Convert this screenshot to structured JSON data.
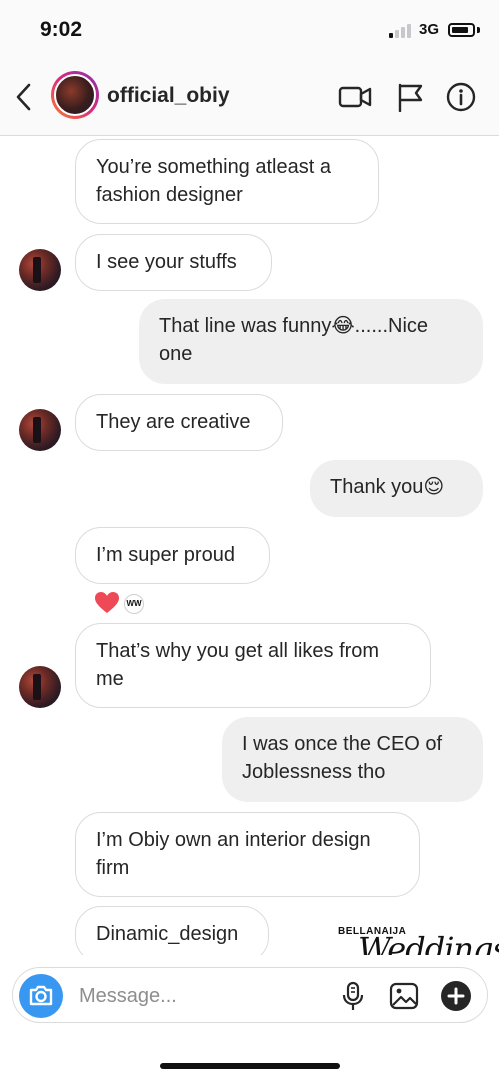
{
  "status_bar": {
    "time": "9:02",
    "network": "3G"
  },
  "header": {
    "username": "official_obiy",
    "icons": [
      "back-chevron-icon",
      "video-call-icon",
      "flag-icon",
      "info-icon"
    ]
  },
  "messages": [
    {
      "side": "in",
      "text": "You’re something atleast a fashion designer"
    },
    {
      "side": "in",
      "text": "I see your stuffs"
    },
    {
      "side": "out",
      "text": "That line was funny😂......Nice one"
    },
    {
      "side": "in",
      "text": "They are creative"
    },
    {
      "side": "out",
      "text": "Thank you😌"
    },
    {
      "side": "in",
      "text": "I’m super proud",
      "reaction": "heart"
    },
    {
      "side": "in",
      "text": "That’s why you get all likes from me"
    },
    {
      "side": "out",
      "text": "I was once the CEO of Joblessness tho"
    },
    {
      "side": "in",
      "text": "I’m Obiy own an interior design firm"
    },
    {
      "side": "in",
      "text": "Dinamic_design"
    }
  ],
  "watermark": {
    "small": "BELLANAIJA",
    "script": "Weddings"
  },
  "composer": {
    "placeholder": "Message...",
    "icons": [
      "camera-icon",
      "microphone-icon",
      "gallery-icon",
      "plus-icon"
    ]
  },
  "colors": {
    "accent": "#3897f0",
    "bubble_out": "#efefef",
    "border": "#dbdbdb",
    "heart": "#ed4956"
  }
}
